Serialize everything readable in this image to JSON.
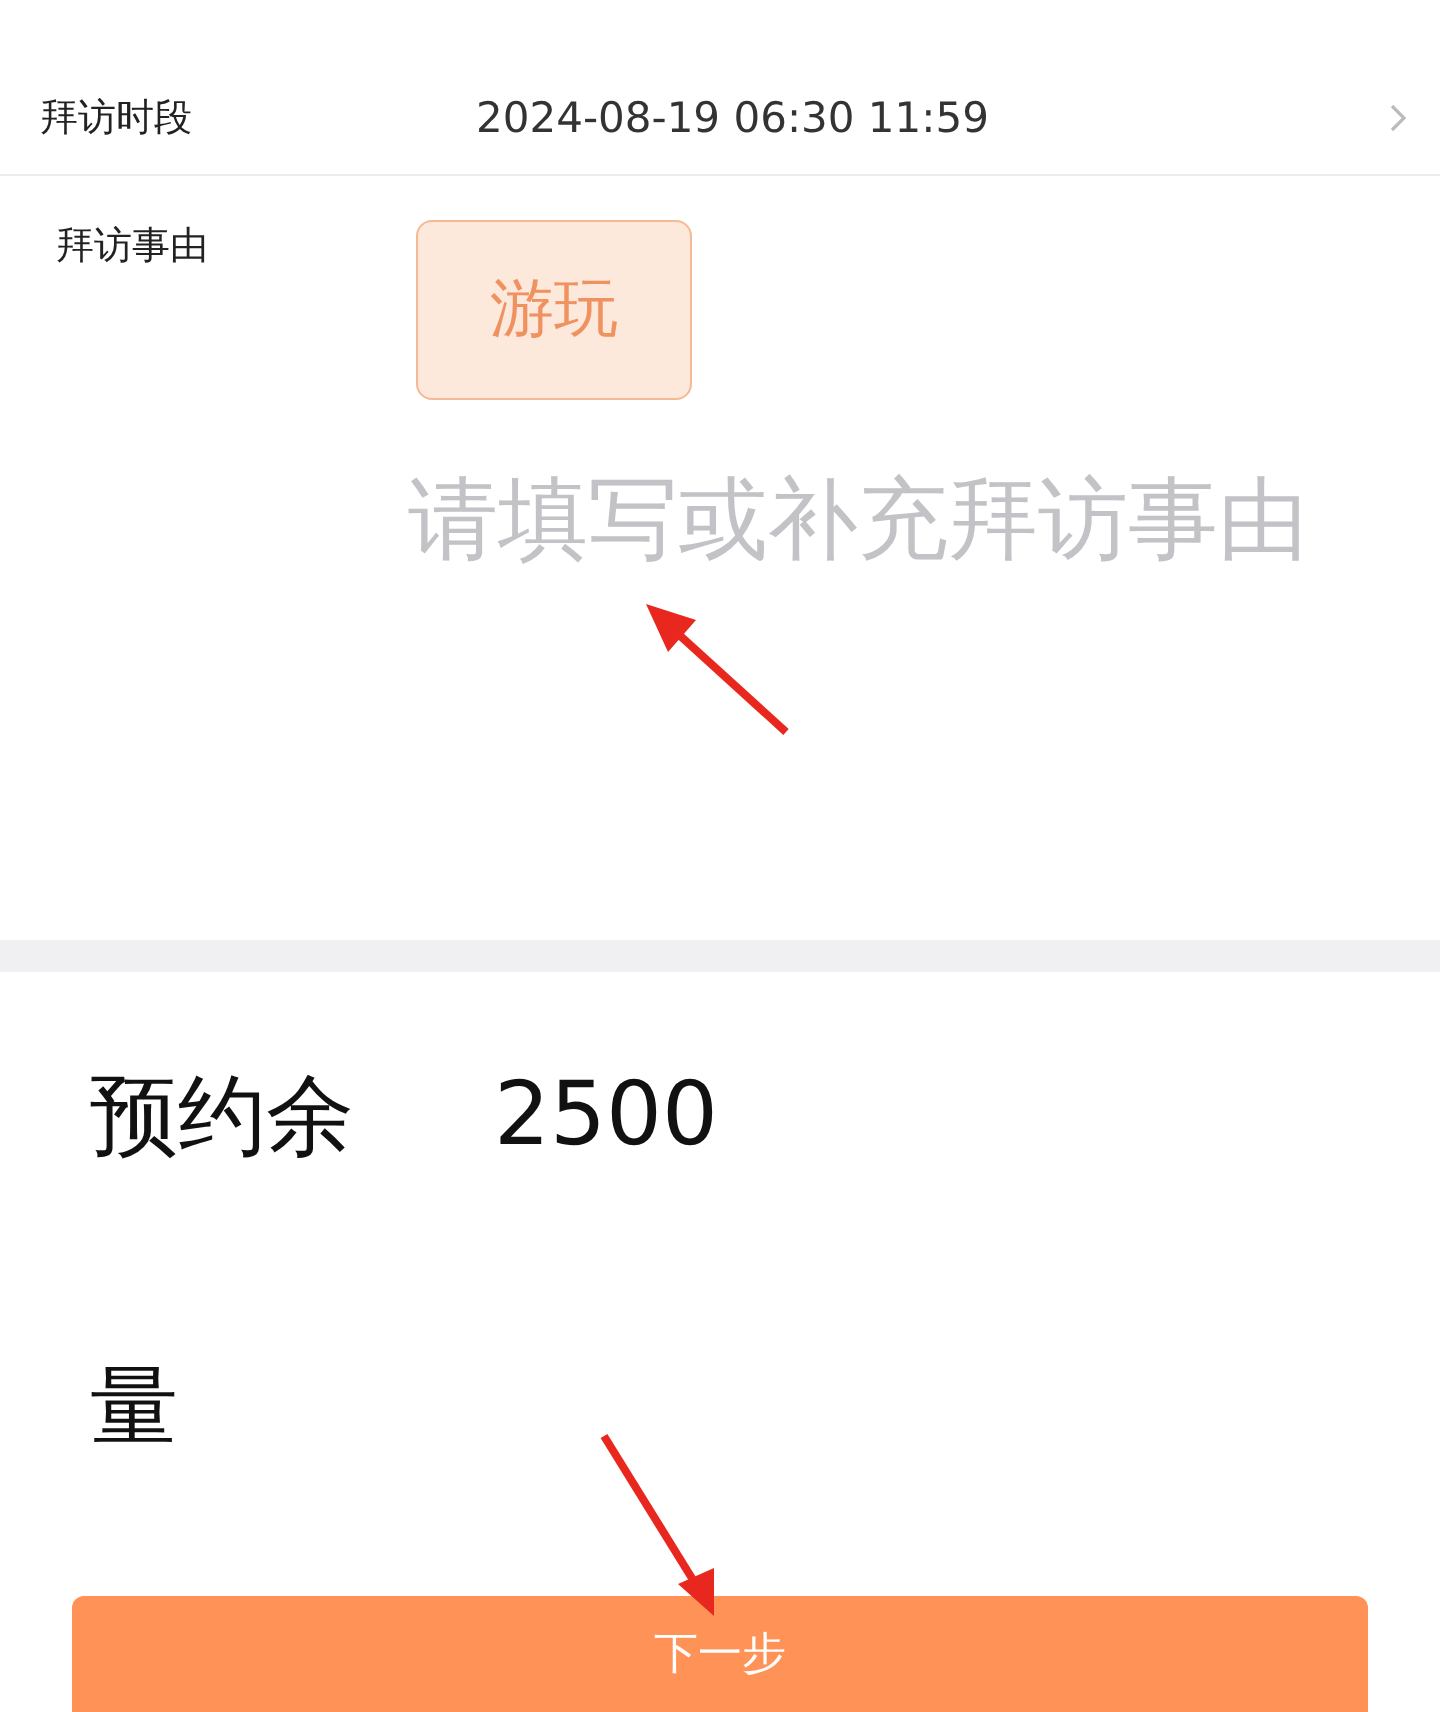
{
  "visit_time": {
    "label": "拜访时段",
    "value": "2024-08-19 06:30 11:59"
  },
  "visit_reason": {
    "label": "拜访事由",
    "tags": [
      {
        "label": "游玩",
        "selected": true
      }
    ],
    "placeholder": "请填写或补充拜访事由"
  },
  "quota": {
    "label": "预约余量",
    "value": "2500"
  },
  "next_button": "下一步"
}
